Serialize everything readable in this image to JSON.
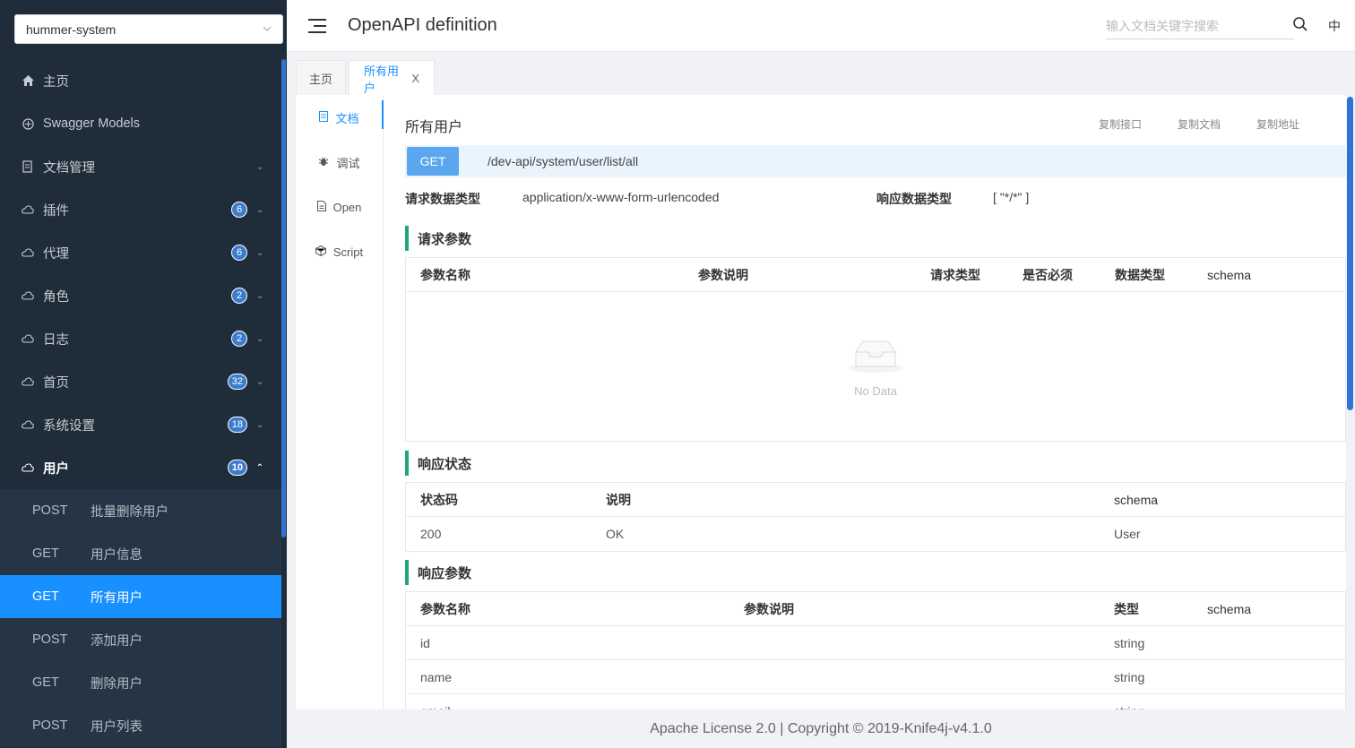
{
  "sidebar": {
    "select_value": "hummer-system",
    "items": [
      {
        "label": "主页",
        "icon": "home-icon"
      },
      {
        "label": "Swagger Models",
        "icon": "models-icon"
      },
      {
        "label": "文档管理",
        "icon": "docs-icon"
      },
      {
        "label": "插件",
        "icon": "cloud-icon",
        "badge": "6"
      },
      {
        "label": "代理",
        "icon": "cloud-icon",
        "badge": "6"
      },
      {
        "label": "角色",
        "icon": "cloud-icon",
        "badge": "2"
      },
      {
        "label": "日志",
        "icon": "cloud-icon",
        "badge": "2"
      },
      {
        "label": "首页",
        "icon": "cloud-icon",
        "badge": "32"
      },
      {
        "label": "系统设置",
        "icon": "cloud-icon",
        "badge": "18"
      },
      {
        "label": "用户",
        "icon": "cloud-icon",
        "badge": "10"
      }
    ],
    "sub_items": [
      {
        "method": "POST",
        "label": "批量删除用户"
      },
      {
        "method": "GET",
        "label": "用户信息"
      },
      {
        "method": "GET",
        "label": "所有用户"
      },
      {
        "method": "POST",
        "label": "添加用户"
      },
      {
        "method": "GET",
        "label": "删除用户"
      },
      {
        "method": "POST",
        "label": "用户列表"
      }
    ]
  },
  "header": {
    "title": "OpenAPI definition",
    "search_placeholder": "输入文档关键字搜索",
    "lang": "中"
  },
  "tabs": [
    {
      "label": "主页"
    },
    {
      "label": "所有用户",
      "close": "X"
    }
  ],
  "vtabs": [
    {
      "label": "文档"
    },
    {
      "label": "调试"
    },
    {
      "label": "Open"
    },
    {
      "label": "Script"
    }
  ],
  "doc": {
    "title": "所有用户",
    "actions": [
      "复制接口",
      "复制文档",
      "复制地址"
    ],
    "method": "GET",
    "url": "/dev-api/system/user/list/all",
    "req_type_label": "请求数据类型",
    "req_type": "application/x-www-form-urlencoded",
    "resp_type_label": "响应数据类型",
    "resp_type": "[ \"*/*\" ]",
    "req_params_title": "请求参数",
    "req_params_headers": [
      "参数名称",
      "参数说明",
      "请求类型",
      "是否必须",
      "数据类型",
      "schema"
    ],
    "no_data": "No Data",
    "resp_status_title": "响应状态",
    "resp_status_headers": [
      "状态码",
      "说明",
      "schema"
    ],
    "resp_status_rows": [
      {
        "code": "200",
        "desc": "OK",
        "schema": "User"
      }
    ],
    "resp_params_title": "响应参数",
    "resp_params_headers": [
      "参数名称",
      "参数说明",
      "类型",
      "schema"
    ],
    "resp_params_rows": [
      {
        "name": "id",
        "type": "string"
      },
      {
        "name": "name",
        "type": "string"
      },
      {
        "name": "email",
        "type": "string"
      }
    ]
  },
  "footer": "Apache License 2.0 | Copyright © 2019-Knife4j-v4.1.0"
}
